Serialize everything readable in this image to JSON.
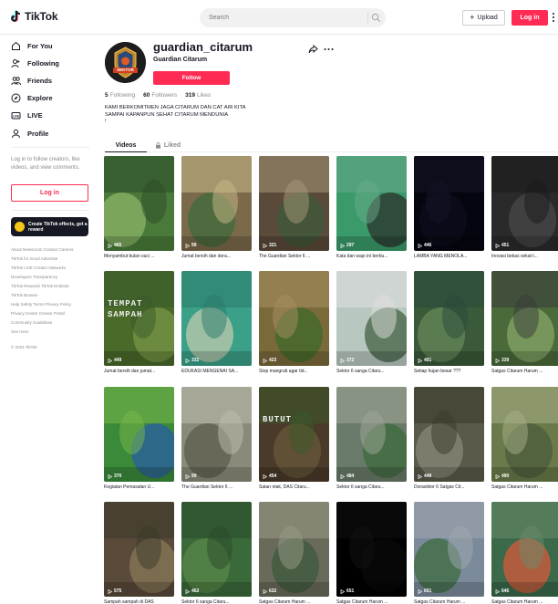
{
  "topbar": {
    "logo_text": "TikTok",
    "search_placeholder": "Search",
    "upload_label": "Upload",
    "login_label": "Log in"
  },
  "sidebar": {
    "nav": [
      {
        "label": "For You",
        "icon": "home-icon"
      },
      {
        "label": "Following",
        "icon": "following-icon"
      },
      {
        "label": "Friends",
        "icon": "friends-icon"
      },
      {
        "label": "Explore",
        "icon": "compass-icon"
      },
      {
        "label": "LIVE",
        "icon": "live-icon"
      },
      {
        "label": "Profile",
        "icon": "profile-icon"
      }
    ],
    "login_prompt": "Log in to follow creators, like videos, and view comments.",
    "login_button": "Log in",
    "effects_card": "Create TikTok effects, get a reward",
    "footer_links": [
      "About  Newsroom  Contact  Careers",
      "TikTok for Good  Advertise",
      "TikTok LIVE Creator Networks",
      "Developers  Transparency",
      "TikTok Rewards  TikTok Embeds",
      "TikTok Browse",
      "Help  Safety  Terms  Privacy Policy",
      "Privacy Center  Creator Portal",
      "Community Guidelines",
      "See more"
    ],
    "copyright": "© 2024 TikTok"
  },
  "profile": {
    "username": "guardian_citarum",
    "nickname": "Guardian Citarum",
    "follow_label": "Follow",
    "stats": [
      {
        "value": "5",
        "label": "Following"
      },
      {
        "value": "60",
        "label": "Followers"
      },
      {
        "value": "319",
        "label": "Likes"
      }
    ],
    "bio_lines": [
      "KAMI BERKOMITMEN JAGA CITARUM DAN CAT AIR KITA",
      "SAMPAI KAPANPUN SEHAT CITARUM MENDUNIA",
      "!"
    ],
    "avatar_text": "SEKTOR"
  },
  "tabs": [
    {
      "label": "Videos",
      "active": true
    },
    {
      "label": "Liked",
      "active": false
    }
  ],
  "videos": [
    {
      "views": "465",
      "caption": "Menyambut bulan suci ...",
      "palette": [
        "#4a7a3a",
        "#8fb86a",
        "#2b4a28"
      ]
    },
    {
      "views": "99",
      "caption": "Jumat bersih dan dora...",
      "palette": [
        "#7a6a4a",
        "#3d6b3a",
        "#c9b98a"
      ]
    },
    {
      "views": "321",
      "caption": "The Guardian Sektor 6 ...",
      "palette": [
        "#5a4a3a",
        "#3b5a3a",
        "#a89878"
      ]
    },
    {
      "views": "297",
      "caption": "Kata dan wajo ini berbu...",
      "palette": [
        "#3a9a6a",
        "#2a2a2a",
        "#6aaa8a"
      ]
    },
    {
      "views": "446",
      "caption": "LAMBA YANG MENOLA...",
      "palette": [
        "#050510",
        "#0d0d1c",
        "#141425"
      ]
    },
    {
      "views": "451",
      "caption": "Inovasi bekas sekat t...",
      "palette": [
        "#2a2a2a",
        "#4a4a4a",
        "#1a1a1a"
      ]
    },
    {
      "views": "449",
      "caption": "Jumat bersih dan jumat...",
      "palette": [
        "#4a6a2a",
        "#7a9a4a",
        "#3a5a2a"
      ]
    },
    {
      "views": "332",
      "caption": "EDUKASI MENGENAI SA...",
      "palette": [
        "#3aa088",
        "#c8ccb0",
        "#2a7a6a"
      ]
    },
    {
      "views": "423",
      "caption": "Stop mangrub agar tid...",
      "palette": [
        "#7a6a3a",
        "#3a6a2a",
        "#a89060"
      ]
    },
    {
      "views": "372",
      "caption": "Sektor 6 sanga Citaru...",
      "palette": [
        "#b8c8c0",
        "#3a5a3a",
        "#e0e0e0"
      ]
    },
    {
      "views": "491",
      "caption": "Setiap hujan besar ???",
      "palette": [
        "#3a5a3a",
        "#6a8a5a",
        "#2a4a3a"
      ]
    },
    {
      "views": "339",
      "caption": "Satgas Citarum Harum ...",
      "palette": [
        "#4a6a3a",
        "#8aaa6a",
        "#3a3a3a"
      ]
    },
    {
      "views": "370",
      "caption": "Kegiatan Pemasalan U...",
      "palette": [
        "#3a8a3a",
        "#2a5aaa",
        "#7ab84a"
      ]
    },
    {
      "views": "99",
      "caption": "The Guardian Sektor 6 ...",
      "palette": [
        "#8a8a7a",
        "#5a5a4a",
        "#c0c0b0"
      ]
    },
    {
      "views": "454",
      "caption": "Satan ntak, DAS Citaru...",
      "palette": [
        "#4a3a2a",
        "#6a5a3a",
        "#3a5a2a"
      ]
    },
    {
      "views": "484",
      "caption": "Sektor 6 sanga Citaru...",
      "palette": [
        "#6a7a6a",
        "#3a6a3a",
        "#a0a898"
      ]
    },
    {
      "views": "448",
      "caption": "Dorasiktor 6 Satgas Cit...",
      "palette": [
        "#5a5a4a",
        "#8a8a7a",
        "#3a3a2a"
      ]
    },
    {
      "views": "490",
      "caption": "Satgas Citarum Harum ...",
      "palette": [
        "#6a7a4a",
        "#4a5a3a",
        "#a8b088"
      ]
    },
    {
      "views": "575",
      "caption": "Sampah sampah di DAS",
      "palette": [
        "#5a4a3a",
        "#8a7a5a",
        "#3a3a2a"
      ]
    },
    {
      "views": "462",
      "caption": "Sektor 6 sanga Citaru...",
      "palette": [
        "#3a6a3a",
        "#5a8a4a",
        "#2a4a2a"
      ]
    },
    {
      "views": "632",
      "caption": "Satgas Citarum Harum ...",
      "palette": [
        "#6a6a5a",
        "#3a5a3a",
        "#9a9a88"
      ]
    },
    {
      "views": "651",
      "caption": "Satgas Citarum Harum ...",
      "palette": [
        "#000000",
        "#0a0a0a",
        "#111111"
      ]
    },
    {
      "views": "651",
      "caption": "Satgas Citarum Harum ...",
      "palette": [
        "#7a8a9a",
        "#3a6a3a",
        "#a0a8b0"
      ]
    },
    {
      "views": "646",
      "caption": "Satgas Citarum Harum ...",
      "palette": [
        "#3a6a4a",
        "#e05a3a",
        "#6a8a6a"
      ]
    }
  ],
  "grid_labels": {
    "thumb_text_6": "TEMPAT SAMPAH",
    "thumb_text_8": "",
    "thumb_text_14": "BUTUT"
  },
  "colors": {
    "accent": "#fe2c55",
    "text_primary": "#161823",
    "text_secondary": "#8a8b91"
  }
}
